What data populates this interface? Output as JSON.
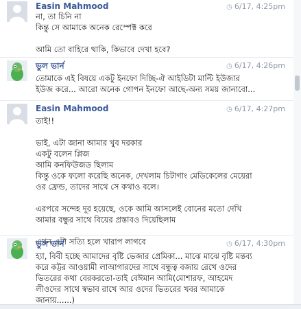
{
  "messages": [
    {
      "sender": "Easin Mahmood",
      "time": "6/17, 4:25pm",
      "avatar": "person-silhouette",
      "lines": [
        "না, তা চিনি না",
        "কিন্তু সে আমাকে অনেক রেস্পেক্ট করে",
        "",
        "আমি তো বাহিরে থাকি, কিভাবে দেখা হবে?"
      ]
    },
    {
      "sender": "ভুল ভার্ন",
      "time": "6/17, 4:26pm",
      "avatar": "green-parrot",
      "lines": [
        "তোমাকে এই বিষয়ে একটু ইনফো দিচ্ছি-ঐ আইডিটা মাল্টি ইউজার",
        "ইউজ করে... আরো অনেক গোপন ইনফো আছে-অন্য সময় জানাবো..."
      ]
    },
    {
      "sender": "Easin Mahmood",
      "time": "6/17, 4:27pm",
      "avatar": "person-silhouette",
      "lines": [
        "তাই!!",
        "",
        "ভাই, এটা জানা আমার খুব দরকার",
        "একটু বলেন প্লিজ",
        "আমি কনফিউজড ছিলাম",
        "কিন্তু ওকে ফলো করেছি অনেক, দেখলাম চিটাগাং মেডিকেলের মেয়েরা",
        "ওর ফ্রেন্ড, তাদের সাথে সে কথাও বলে।",
        "",
        "এরপরে সন্দেহ দূর হয়েছে, ওকে আমি আসলেই বোনের মতো দেখি",
        "আমার বন্ধুর সাথে বিয়ের প্রস্তাবও দিয়েছিলাম",
        "",
        "এখন এটা সত্যি হলে খারাপ লাগবে"
      ]
    },
    {
      "sender": "ভুল ভার্ন",
      "time": "6/17, 4:30pm",
      "avatar": "green-parrot",
      "lines": [
        "হ্যা, বিবী হচ্ছে আমাদের বৃষ্টি ভেজার প্রেমিকা... মাঝে মাঝে বৃষ্টি মন্তব্য",
        "করে কট্টর আওয়ামী লাআগারদের সাথে বন্ধুত্ব বজায় রেখে ওদের",
        "ভিতরের কথা বেরকরতো-তাই বেঈমান আমি(মোশারফ, আহমেদ",
        "লীওদের সাথে স্বভাব রাখে আর ওদের ভিতরের খবর আমাকে",
        "জানায়......)"
      ]
    }
  ],
  "colors": {
    "sender": "#3b5998",
    "timestamp": "#8f97a6",
    "separator": "#e6e9f0"
  }
}
